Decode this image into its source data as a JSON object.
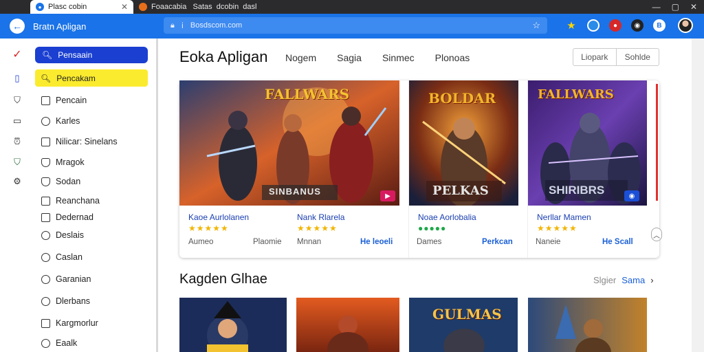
{
  "browser": {
    "active_tab_title": "Plasc cobin",
    "inactive_tab_title": "Foaacabia   Satas  dcobin  dasl",
    "nav_title": "Bratn Apligan",
    "url": "Bosdscom.com"
  },
  "sidebar": {
    "search_active": "Pensaain",
    "search_highlight": "Pencakam",
    "items": [
      {
        "label": "Pencain",
        "icon": "square-icon"
      },
      {
        "label": "Karles",
        "icon": "circle-icon"
      },
      {
        "label": "Nilicar: Sinelans",
        "icon": "square-icon"
      },
      {
        "label": "Mragok",
        "icon": "shield-icon"
      },
      {
        "label": "Sodan",
        "icon": "shield-icon"
      },
      {
        "label": "Reanchana",
        "icon": "square-icon"
      },
      {
        "label": "Dedernad",
        "icon": "square-icon"
      },
      {
        "label": "Deslais",
        "icon": "clock-icon"
      },
      {
        "label": "Caslan",
        "icon": "search-icon"
      },
      {
        "label": "Garanian",
        "icon": "circle-icon"
      },
      {
        "label": "Dlerbans",
        "icon": "circle-icon"
      },
      {
        "label": "Kargmorlur",
        "icon": "square-icon"
      },
      {
        "label": "Eaalk",
        "icon": "clock-icon"
      }
    ]
  },
  "main": {
    "title": "Eoka Apligan",
    "tabs": [
      "Nogem",
      "Sagia",
      "Sinmec",
      "Plonoas"
    ],
    "segmented": [
      "Liopark",
      "Sohlde"
    ],
    "featured_cards": [
      {
        "name_left": "Kaoe Aurlolanen",
        "name_right": "Nank Rlarela",
        "stars_left": "★★★★★",
        "stars_right": "★★★★★",
        "meta_left": "Aumeo",
        "meta_mid": "Plaomie",
        "meta_right": "Mnnan",
        "link": "He leoeli",
        "banner": "FALLWARS",
        "subtitle": "SINBANUS"
      },
      {
        "name": "Noae Aorlobalia",
        "stars": "●●●●●",
        "meta": "Dames",
        "link": "Perkcan",
        "banner": "BOLDAR",
        "subtitle": "PELKAS"
      },
      {
        "name": "Nerllar Mamen",
        "stars": "★★★★★",
        "meta": "Naneie",
        "link": "He Scall",
        "banner": "FALLWARS",
        "subtitle": "SHIRIBRS"
      }
    ],
    "section_title": "Kagden Glhae",
    "section_link_gray": "Slgier",
    "section_link_blue": "Sama",
    "thumb_banner": "GULMAS",
    "colors": {
      "accent_blue": "#1a73e8",
      "sidebar_highlight": "#fbeb2e",
      "star_gold": "#f2b500",
      "star_green": "#1fa84a",
      "link_blue": "#1a5fd6"
    }
  }
}
